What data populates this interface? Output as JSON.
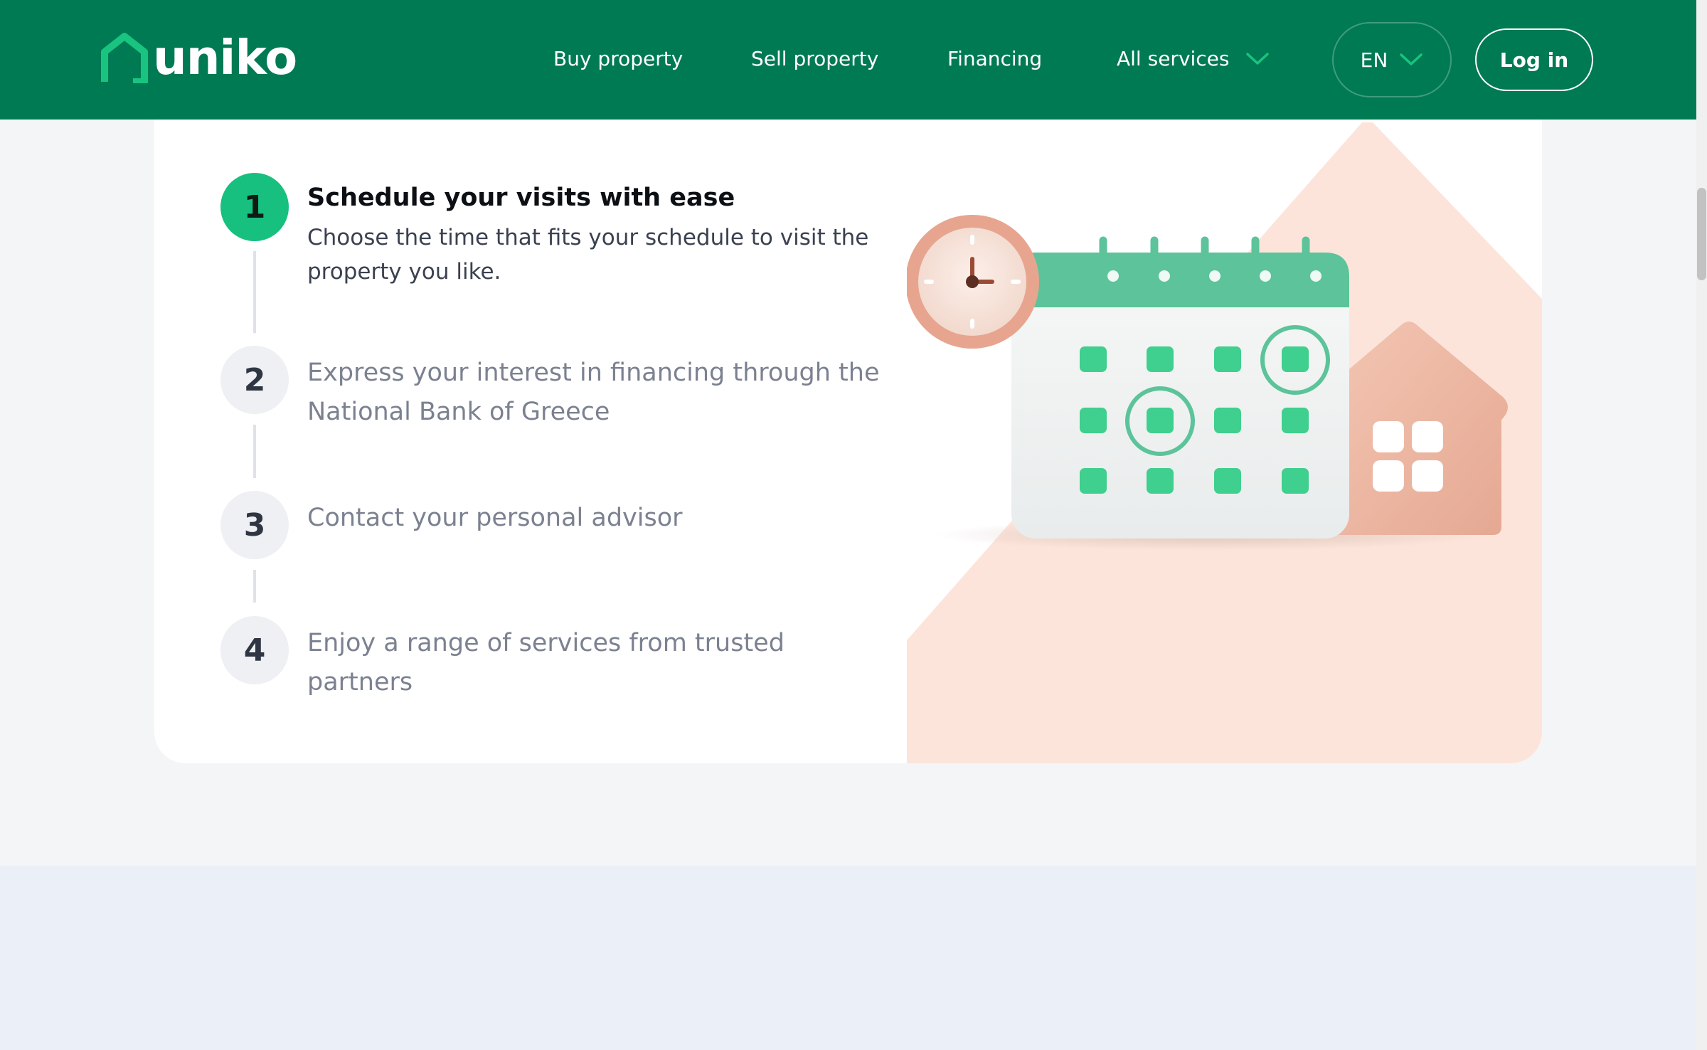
{
  "header": {
    "logo_text": "uniko",
    "nav": {
      "buy": "Buy property",
      "sell": "Sell property",
      "financing": "Financing",
      "all_services": "All services"
    },
    "language": "EN",
    "login": "Log in"
  },
  "steps": [
    {
      "number": "1",
      "title": "Schedule your visits with ease",
      "description": "Choose the time that fits your schedule to visit the property you like.",
      "active": true
    },
    {
      "number": "2",
      "text": "Express your interest in financing through the National Bank of Greece",
      "active": false
    },
    {
      "number": "3",
      "text": "Contact your personal advisor",
      "active": false
    },
    {
      "number": "4",
      "text": "Enjoy a range of services from trusted partners",
      "active": false
    }
  ],
  "colors": {
    "header_bg": "#007a53",
    "accent_green": "#17c07f",
    "illustration_bg": "#fde4da",
    "page_bg": "#f4f5f7",
    "bottom_band": "#ebeff7"
  },
  "icons": {
    "logo": "house-outline-icon",
    "dropdown": "chevron-down-icon",
    "illustration": "calendar-clock-house-illustration"
  }
}
